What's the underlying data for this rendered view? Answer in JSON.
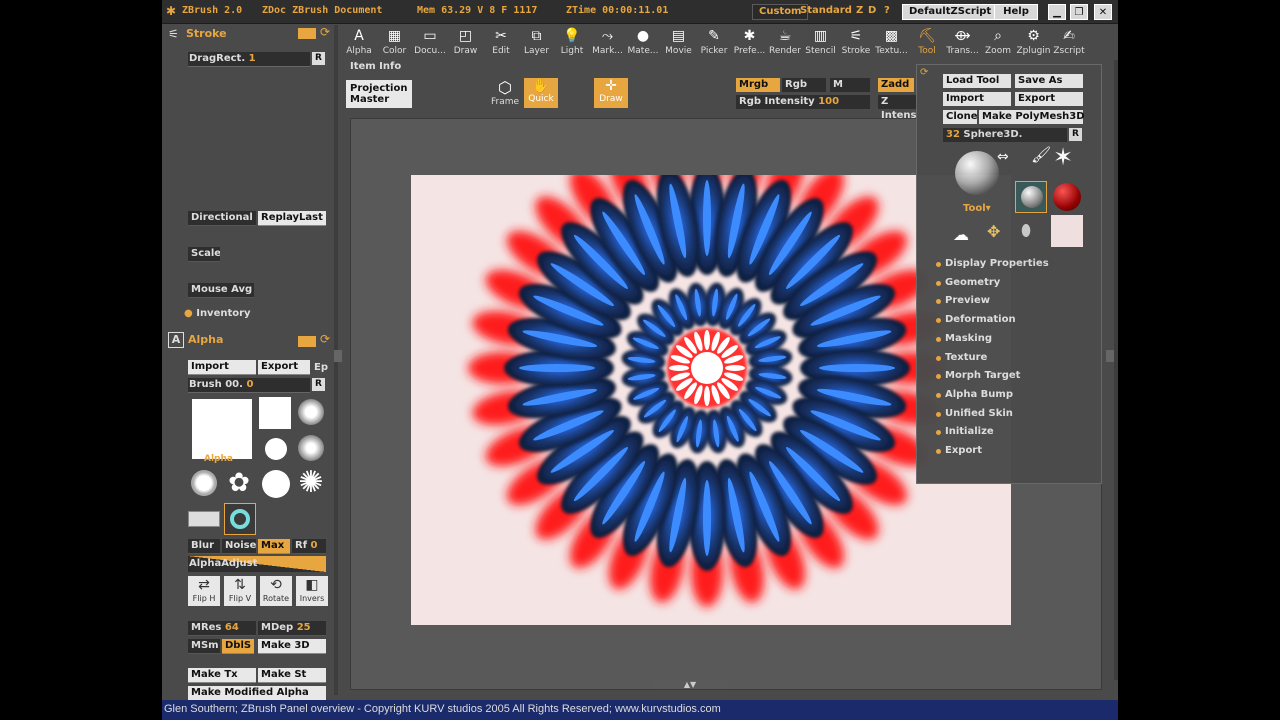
{
  "titlebar": {
    "app": "ZBrush 2.0",
    "doc": "ZDoc ZBrush Document",
    "mem": "Mem 63.29 V 8 F 1117",
    "ztime": "ZTime 00:00:11.01",
    "custom": "Custom",
    "standard": "Standard",
    "z": "Z",
    "d": "D",
    "help_q": "?",
    "script": "DefaultZScript",
    "help": "Help"
  },
  "menu": [
    {
      "label": "Alpha",
      "icon": "A"
    },
    {
      "label": "Color",
      "icon": "▦"
    },
    {
      "label": "Docu...",
      "icon": "▭"
    },
    {
      "label": "Draw",
      "icon": "◰"
    },
    {
      "label": "Edit",
      "icon": "✂"
    },
    {
      "label": "Layer",
      "icon": "⧉"
    },
    {
      "label": "Light",
      "icon": "💡"
    },
    {
      "label": "Mark...",
      "icon": "⤳"
    },
    {
      "label": "Mate...",
      "icon": "●"
    },
    {
      "label": "Movie",
      "icon": "▤"
    },
    {
      "label": "Picker",
      "icon": "✎"
    },
    {
      "label": "Prefe...",
      "icon": "✱"
    },
    {
      "label": "Render",
      "icon": "☕"
    },
    {
      "label": "Stencil",
      "icon": "▥"
    },
    {
      "label": "Stroke",
      "icon": "⚟"
    },
    {
      "label": "Textu...",
      "icon": "▩"
    },
    {
      "label": "Tool",
      "icon": "⛏"
    },
    {
      "label": "Trans...",
      "icon": "⟴"
    },
    {
      "label": "Zoom",
      "icon": "⌕"
    },
    {
      "label": "Zplugin",
      "icon": "⚙"
    },
    {
      "label": "Zscript",
      "icon": "✍"
    }
  ],
  "left": {
    "stroke_title": "Stroke",
    "dragrect": "DragRect.",
    "dragrect_val": "1",
    "r": "R",
    "directional": "Directional",
    "replaylast": "ReplayLast",
    "scale": "Scale",
    "mouse_avg": "Mouse Avg",
    "inventory": "Inventory",
    "alpha_title": "Alpha",
    "import": "Import",
    "export": "Export",
    "ep": "Ep",
    "brush": "Brush 00.",
    "brush_val": "0",
    "alpha_label": "Alpha",
    "blur": "Blur",
    "noise": "Noise",
    "max": "Max",
    "rf": "Rf",
    "rf_val": "0",
    "alphaadjust": "AlphaAdjust",
    "fliph": "Flip H",
    "flipv": "Flip V",
    "rotate": "Rotate",
    "invers": "Invers",
    "mres": "MRes",
    "mres_val": "64",
    "mdep": "MDep",
    "mdep_val": "25",
    "msm": "MSm",
    "dbls": "DblS",
    "make3d": "Make 3D",
    "maketx": "Make Tx",
    "makest": "Make St",
    "makemod": "Make Modified Alpha"
  },
  "topbar": {
    "item_info": "Item Info",
    "projection_master": "Projection Master",
    "frame": "Frame",
    "quick": "Quick",
    "draw": "Draw",
    "mrgb": "Mrgb",
    "rgb": "Rgb",
    "m": "M",
    "zadd": "Zadd",
    "rgb_intensity": "Rgb Intensity",
    "rgb_intensity_val": "100",
    "z_intens": "Z Intens"
  },
  "toolpanel": {
    "load_tool": "Load Tool",
    "save_as": "Save As",
    "import": "Import",
    "export": "Export",
    "clone": "Clone",
    "make_polymesh": "Make PolyMesh3D",
    "current_tool_num": "32",
    "current_tool": "Sphere3D.",
    "r": "R",
    "tool_label": "Tool",
    "items": [
      "Display Properties",
      "Geometry",
      "Preview",
      "Deformation",
      "Masking",
      "Texture",
      "Morph Target",
      "Alpha Bump",
      "Unified Skin",
      "Initialize",
      "Export"
    ]
  },
  "status": "Glen Southern; ZBrush Panel overview - Copyright KURV studios 2005 All Rights Reserved; www.kurvstudios.com",
  "colors": {
    "accent": "#e8a640",
    "panel": "#4a4a4a",
    "status_bg": "#1a2a6a"
  }
}
